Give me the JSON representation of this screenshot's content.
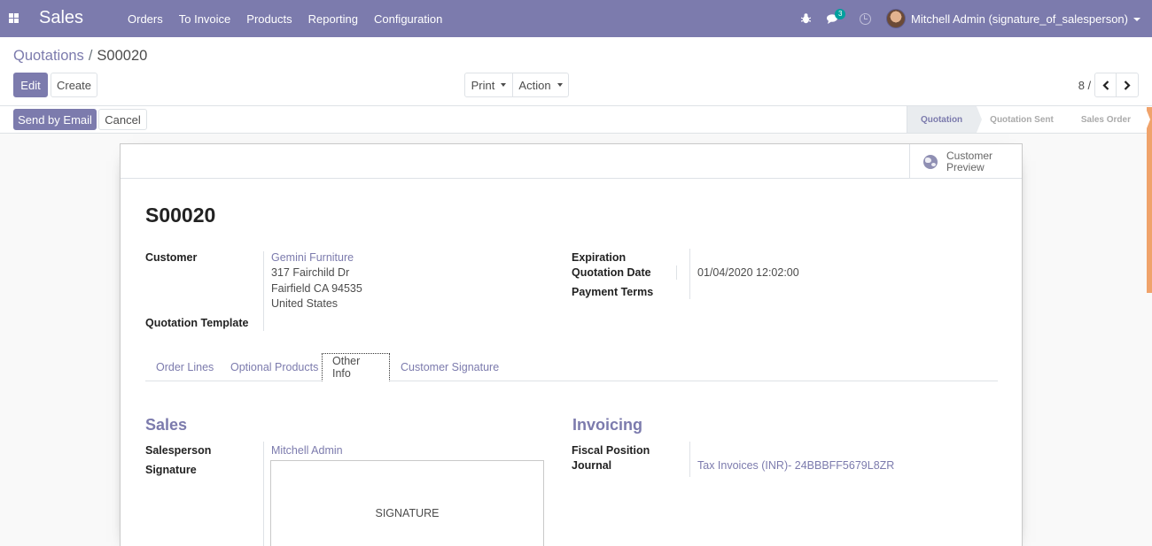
{
  "navbar": {
    "app_name": "Sales",
    "menu": [
      "Orders",
      "To Invoice",
      "Products",
      "Reporting",
      "Configuration"
    ],
    "chat_count": "3",
    "user": "Mitchell Admin (signature_of_salesperson)",
    "icons": [
      "apps-icon",
      "bug-icon",
      "chat-icon",
      "clock-icon",
      "avatar"
    ]
  },
  "breadcrumb": {
    "parent": "Quotations",
    "separator": "/",
    "current": "S00020"
  },
  "buttons": {
    "edit": "Edit",
    "create": "Create",
    "print": "Print",
    "action": "Action",
    "send_email": "Send by Email",
    "cancel": "Cancel"
  },
  "pager": {
    "value": "8 / 8"
  },
  "statusbar": [
    "Quotation",
    "Quotation Sent",
    "Sales Order"
  ],
  "stat_button": {
    "line1": "Customer",
    "line2": "Preview"
  },
  "record": {
    "name": "S00020",
    "customer_label": "Customer",
    "customer_name": "Gemini Furniture",
    "address_1": "317 Fairchild Dr",
    "address_2": "Fairfield CA 94535",
    "address_3": "United States",
    "template_label": "Quotation Template",
    "expiration_label": "Expiration",
    "quotation_date_label": "Quotation Date",
    "quotation_date": "01/04/2020 12:02:00",
    "payment_terms_label": "Payment Terms"
  },
  "tabs": [
    "Order Lines",
    "Optional Products",
    "Other Info",
    "Customer Signature"
  ],
  "other_info": {
    "sales_title": "Sales",
    "salesperson_label": "Salesperson",
    "salesperson": "Mitchell Admin",
    "signature_label": "Signature",
    "signature_placeholder": "SIGNATURE",
    "invoicing_title": "Invoicing",
    "fiscal_position_label": "Fiscal Position",
    "journal_label": "Journal",
    "journal": "Tax Invoices (INR)- 24BBBFF5679L8ZR"
  },
  "colors": {
    "brand": "#7c7bad",
    "badge": "#00a09d",
    "stage_active_bg": "#e9ecef"
  }
}
